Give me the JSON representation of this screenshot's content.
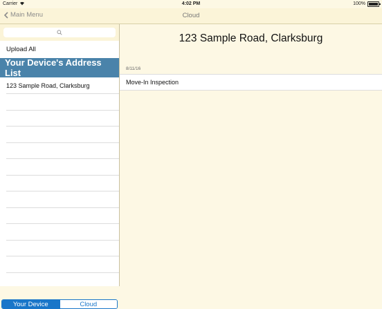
{
  "status_bar": {
    "carrier": "Carrier",
    "time": "4:02 PM",
    "battery": "100%"
  },
  "nav": {
    "back_label": "Main Menu",
    "title": "Cloud"
  },
  "sidebar": {
    "search_placeholder": "",
    "upload_all": "Upload All",
    "list_header": "Your Device's Address List",
    "addresses": [
      "123 Sample Road, Clarksburg"
    ]
  },
  "segmented": {
    "your_device": "Your Device",
    "cloud": "Cloud",
    "selected": "Your Device"
  },
  "detail": {
    "title": "123 Sample Road, Clarksburg",
    "date": "8/11/16",
    "inspection": "Move-In Inspection"
  },
  "colors": {
    "header_blue": "#4a83aa",
    "segment_blue": "#1976c9",
    "background": "#fdf8e4"
  }
}
